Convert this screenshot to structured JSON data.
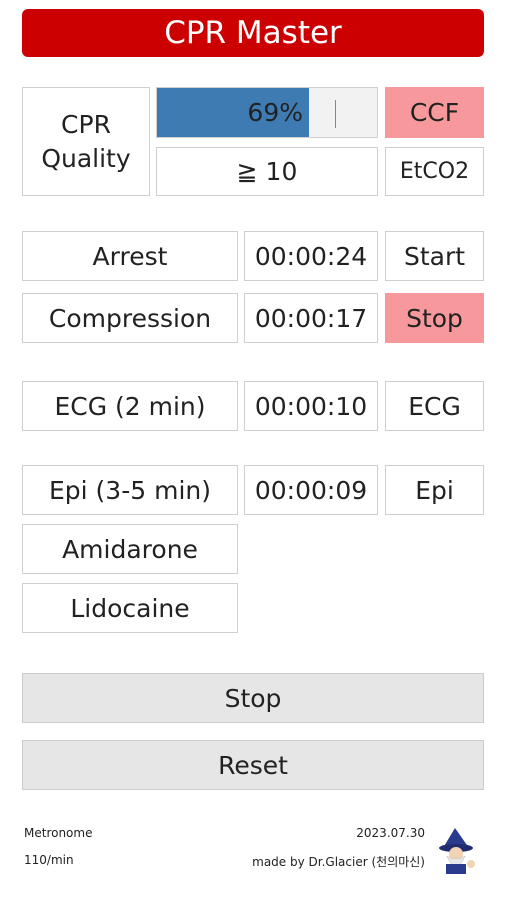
{
  "app": {
    "title": "CPR Master"
  },
  "quality": {
    "label_line1": "CPR",
    "label_line2": "Quality",
    "ccf_percent_text": "69%",
    "ccf_fraction": 0.69,
    "ccf_button": "CCF",
    "etco2_value": "≧ 10",
    "etco2_button": "EtCO2"
  },
  "timers": {
    "arrest": {
      "label": "Arrest",
      "time": "00:00:24",
      "button": "Start"
    },
    "compression": {
      "label": "Compression",
      "time": "00:00:17",
      "button": "Stop"
    },
    "ecg": {
      "label": "ECG (2 min)",
      "time": "00:00:10",
      "button": "ECG"
    },
    "epi": {
      "label": "Epi (3-5 min)",
      "time": "00:00:09",
      "button": "Epi"
    }
  },
  "drugs": {
    "amidarone": "Amidarone",
    "lidocaine": "Lidocaine"
  },
  "actions": {
    "stop": "Stop",
    "reset": "Reset"
  },
  "footer": {
    "metronome_label": "Metronome",
    "metronome_rate": "110/min",
    "date": "2023.07.30",
    "credit": "made by Dr.Glacier (천의마신)"
  },
  "colors": {
    "header": "#cc0000",
    "active_button": "#f7999c",
    "progress": "#3e7bb3"
  },
  "icons": {
    "logo": "wizard-icon"
  }
}
